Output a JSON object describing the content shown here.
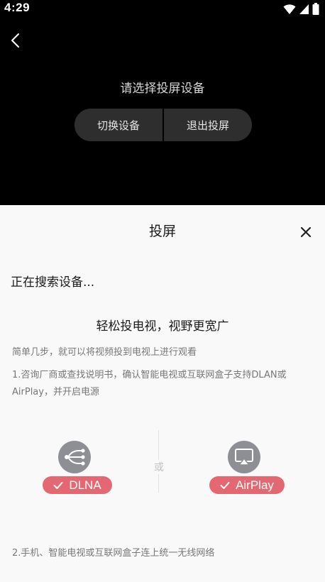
{
  "status_bar": {
    "time": "4:29",
    "icons": [
      "wifi-icon",
      "signal-icon",
      "battery-icon"
    ]
  },
  "cast_area": {
    "back_icon": "chevron-left-icon",
    "prompt": "请选择投屏设备",
    "switch_device_label": "切换设备",
    "exit_cast_label": "退出投屏"
  },
  "sheet": {
    "title": "投屏",
    "close_icon": "close-icon",
    "searching": "正在搜索设备...",
    "slogan": "轻松投电视，视野更宽广",
    "intro": "简单几步，就可以将视频投到电视上进行观看",
    "step1": "1.咨询厂商或查找说明书，确认智能电视或互联网盒子支持DLAN或AirPlay，并开启电源",
    "dlna_label": "DLNA",
    "or_label": "或",
    "airplay_label": "AirPlay",
    "step2": "2.手机、智能电视或互联网盒子连上统一无线网络"
  },
  "colors": {
    "accent_pill": "#e36872",
    "protocol_icon_bg": "#8e8e95",
    "sheet_bg": "#faf9fa",
    "top_bg": "#000000"
  }
}
